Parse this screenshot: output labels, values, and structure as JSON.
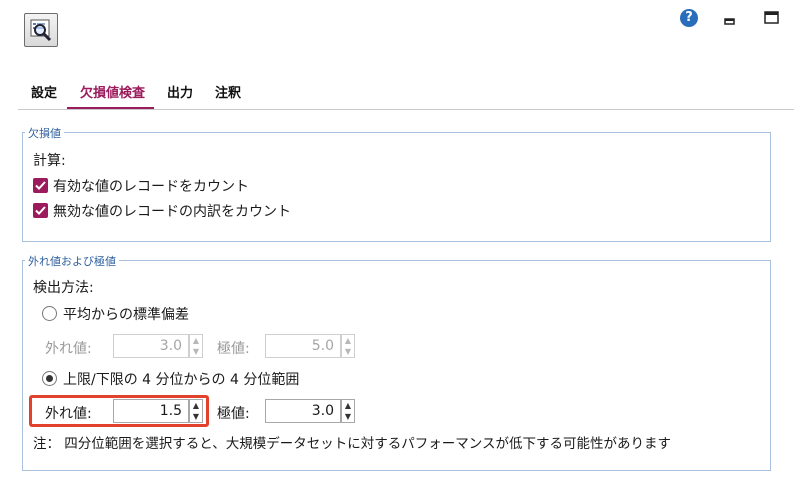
{
  "app": {
    "icon": "report-magnifier-icon",
    "help_icon": "help-question-icon",
    "help_glyph": "?"
  },
  "window": {
    "minimize_icon": "minimize-icon",
    "maximize_icon": "maximize-icon"
  },
  "tabs": [
    {
      "label": "設定",
      "active": false
    },
    {
      "label": "欠損値検査",
      "active": true
    },
    {
      "label": "出力",
      "active": false
    },
    {
      "label": "注釈",
      "active": false
    }
  ],
  "missing_group": {
    "legend": "欠損値",
    "calc_label": "計算:",
    "checkboxes": [
      {
        "label": "有効な値のレコードをカウント",
        "checked": true
      },
      {
        "label": "無効な値のレコードの内訳をカウント",
        "checked": true
      }
    ]
  },
  "outlier_group": {
    "legend": "外れ値および極値",
    "method_label": "検出方法:",
    "option_stddev": {
      "label": "平均からの標準偏差",
      "selected": false,
      "outlier_label": "外れ値:",
      "outlier_value": "3.0",
      "extreme_label": "極値:",
      "extreme_value": "5.0"
    },
    "option_iqr": {
      "label": "上限/下限の 4 分位からの 4 分位範囲",
      "selected": true,
      "outlier_label": "外れ値:",
      "outlier_value": "1.5",
      "extreme_label": "極値:",
      "extreme_value": "3.0"
    },
    "note": "注： 四分位範囲を選択すると、大規模データセットに対するパフォーマンスが低下する可能性があります"
  },
  "colors": {
    "accent": "#9b1b5c",
    "group_border": "#a9c1dd",
    "legend": "#2f5f9e",
    "highlight": "#e2412b",
    "help": "#2a6ebb"
  }
}
